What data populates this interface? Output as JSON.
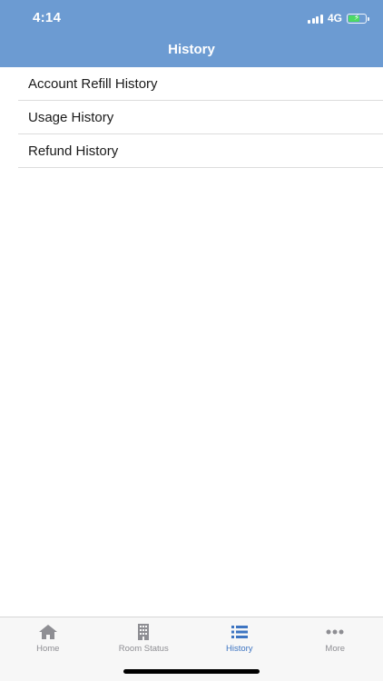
{
  "status_bar": {
    "time": "4:14",
    "network": "4G"
  },
  "header": {
    "title": "History"
  },
  "history_list": [
    {
      "label": "Account Refill History"
    },
    {
      "label": "Usage History"
    },
    {
      "label": "Refund History"
    }
  ],
  "tabbar": {
    "active_tab": "History",
    "tabs": [
      {
        "label": "Home",
        "icon": "home-icon"
      },
      {
        "label": "Room Status",
        "icon": "building-icon"
      },
      {
        "label": "History",
        "icon": "list-icon"
      },
      {
        "label": "More",
        "icon": "more-icon"
      }
    ]
  },
  "colors": {
    "header": "#6c9bd2",
    "active_tab": "#3e75c2",
    "inactive_tab": "#8e8e93"
  }
}
